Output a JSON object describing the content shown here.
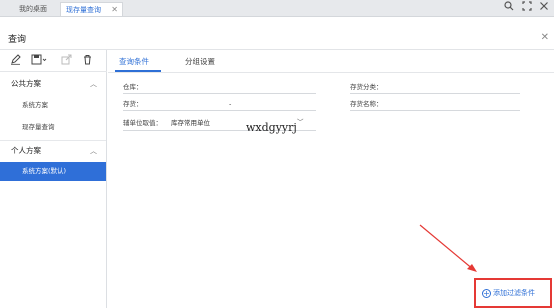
{
  "tabs": {
    "home_label": "我的桌面",
    "active_label": "现存量查询",
    "close_glyph": "✕"
  },
  "toolbar_icons": [
    "search-icon",
    "maximize-icon",
    "close-icon"
  ],
  "dialog": {
    "title": "查询",
    "close_glyph": "✕"
  },
  "left_pane": {
    "public_group": "公共方案",
    "public_items": [
      "系统方案",
      "现存量查询"
    ],
    "personal_group": "个人方案",
    "personal_items": [
      "系统方案(默认)"
    ]
  },
  "right_pane": {
    "tabs": [
      "查询条件",
      "分组设置"
    ],
    "fields": {
      "warehouse_label": "仓库：",
      "inventory_label": "存货：",
      "inventory_dash": "-",
      "unit_label": "辅单位取值：",
      "unit_value": "库存常用单位",
      "category_label": "存货分类：",
      "name_label": "存货名称："
    },
    "handwritten_text": "wxdgyyrj",
    "add_filter_label": "添加过滤条件"
  },
  "colors": {
    "accent": "#2e6fd6",
    "highlight": "#e53935"
  }
}
